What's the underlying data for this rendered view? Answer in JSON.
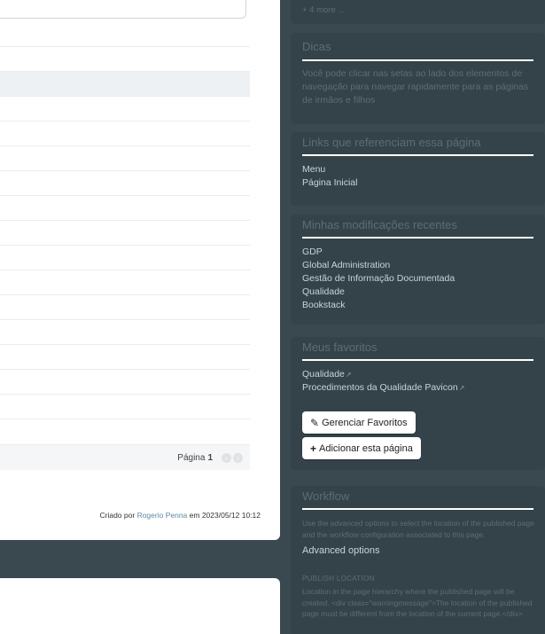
{
  "content": {
    "pager": {
      "label": "Página",
      "current": "1"
    },
    "credit": {
      "prefix": "Criado por",
      "author": "Rogerio Penna",
      "suffix": "em 2023/05/12 10:12"
    }
  },
  "sidebar": {
    "more": "+ 4 more ...",
    "tips": {
      "title": "Dicas",
      "text": "Você pode clicar nas setas ao lado dos elementos de navegação para navegar rapidamente para as páginas de irmãos e filhos"
    },
    "backlinks": {
      "title": "Links que referenciam essa página",
      "items": [
        "Menu",
        "Página Inicial"
      ]
    },
    "recent": {
      "title": "Minhas modificações recentes",
      "items": [
        "GDP",
        "Global Administration",
        "Gestão de Informação Documentada",
        "Qualidade",
        "Bookstack"
      ]
    },
    "favorites": {
      "title": "Meus favoritos",
      "items": [
        "Qualidade",
        "Procedimentos da Qualidade Pavicon"
      ],
      "manage_label": "Gerenciar Favoritos",
      "add_label": "Adicionar esta página"
    },
    "workflow": {
      "title": "Workflow",
      "intro": "Use the advanced options to select the location of the published page and the workflow configuration associated to this page.",
      "advanced": "Advanced options",
      "location_label": "PUBLISH LOCATION",
      "location_help": "Location in the page hierarchy where the published page will be created. <div class=\"warningmessage\">The location of the published page must be different from the location of the current page.</div>"
    }
  }
}
